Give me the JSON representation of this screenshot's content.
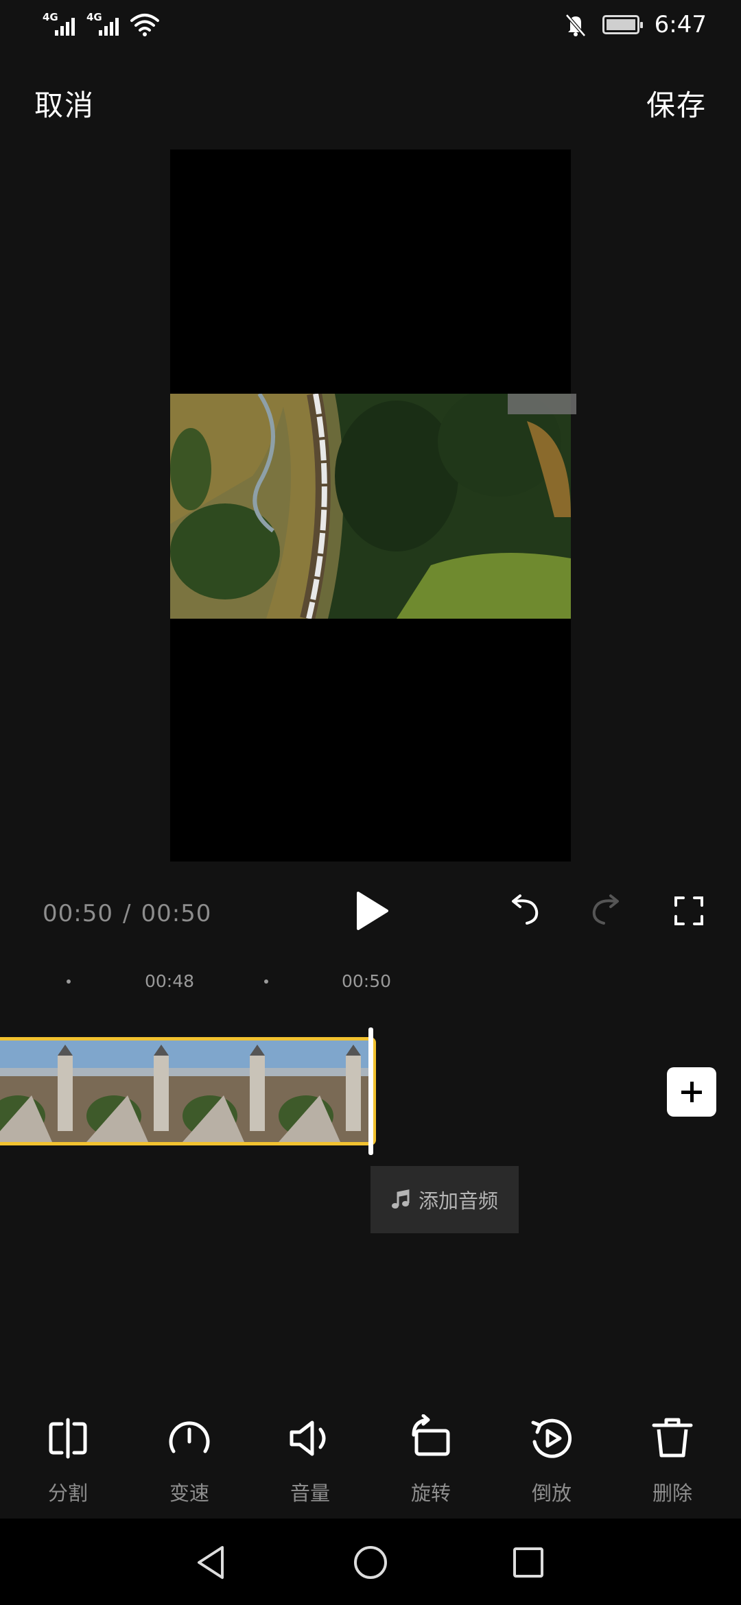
{
  "status_bar": {
    "signal_1_label": "4G",
    "signal_2_label": "4G",
    "time": "6:47",
    "icons": [
      "signal-icon",
      "signal-icon",
      "wifi-icon",
      "bell-muted-icon",
      "battery-charging-icon"
    ]
  },
  "header": {
    "cancel_label": "取消",
    "save_label": "保存"
  },
  "player": {
    "current_time": "00:50",
    "separator": "/",
    "total_time": "00:50"
  },
  "timeline": {
    "ruler_labels": [
      "00:48",
      "00:50"
    ]
  },
  "audio": {
    "add_label": "添加音频"
  },
  "toolbar": {
    "items": [
      {
        "label": "分割",
        "icon": "split-icon"
      },
      {
        "label": "变速",
        "icon": "speed-gauge-icon"
      },
      {
        "label": "音量",
        "icon": "volume-icon"
      },
      {
        "label": "旋转",
        "icon": "rotate-icon"
      },
      {
        "label": "倒放",
        "icon": "reverse-play-icon"
      },
      {
        "label": "删除",
        "icon": "trash-icon"
      }
    ]
  },
  "colors": {
    "background": "#121212",
    "clip_border": "#f2c230",
    "muted_text": "#8e8e8e"
  }
}
